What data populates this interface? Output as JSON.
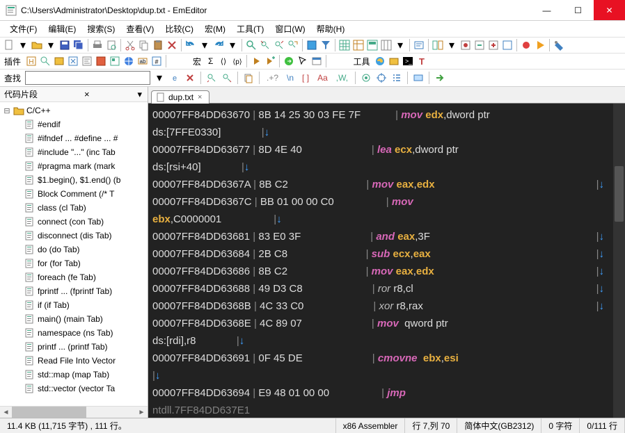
{
  "window": {
    "title": "C:\\Users\\Administrator\\Desktop\\dup.txt - EmEditor",
    "min": "—",
    "max": "☐",
    "close": "✕"
  },
  "menu": [
    "文件(F)",
    "编辑(E)",
    "搜索(S)",
    "查看(V)",
    "比较(C)",
    "宏(M)",
    "工具(T)",
    "窗口(W)",
    "帮助(H)"
  ],
  "toolbar2": {
    "plugins_label": "插件",
    "macros_label": "宏",
    "sigma": "Σ",
    "tools_label": "工具"
  },
  "search": {
    "label": "查找",
    "value": "",
    "tokens": [
      ".+?",
      "\\n",
      "[ ]",
      "Aa",
      ",W,"
    ]
  },
  "sidebar": {
    "title": "代码片段",
    "root": "C/C++",
    "items": [
      "#endif",
      "#ifndef ... #define ... #",
      "#include \"...\"  (inc Tab",
      "#pragma mark  (mark",
      "$1.begin(), $1.end()  (b",
      "Block Comment  (/* T",
      "class  (cl Tab)",
      "connect  (con Tab)",
      "disconnect  (dis Tab)",
      "do  (do Tab)",
      "for  (for Tab)",
      "foreach  (fe Tab)",
      "fprintf ...  (fprintf Tab)",
      "if  (if Tab)",
      "main()  (main Tab)",
      "namespace  (ns Tab)",
      "printf ...  (printf Tab)",
      "Read File Into Vector",
      "std::map  (map Tab)",
      "std::vector  (vector Ta"
    ]
  },
  "tab": {
    "label": "dup.txt"
  },
  "code": {
    "lines": [
      {
        "t": "a",
        "addr": "00007FF84DD63670",
        "hex": "8B 14 25 30 03 FE 7F",
        "mnem": "mov",
        "ops": [
          {
            "r": "edx"
          },
          {
            "p": ",dword ptr"
          }
        ]
      },
      {
        "t": "c",
        "txt": "ds:[7FFE0330]",
        "arrow": true
      },
      {
        "t": "a",
        "addr": "00007FF84DD63677",
        "hex": "8D 4E 40",
        "mnem": "lea",
        "ops": [
          {
            "r": "ecx"
          },
          {
            "p": ",dword ptr"
          }
        ]
      },
      {
        "t": "c",
        "txt": "ds:[rsi+40]",
        "arrow": true
      },
      {
        "t": "a",
        "addr": "00007FF84DD6367A",
        "hex": "8B C2",
        "mnem": "mov",
        "ops": [
          {
            "r": "eax"
          },
          {
            "p": ","
          },
          {
            "r": "edx"
          }
        ],
        "rarrow": true
      },
      {
        "t": "a",
        "addr": "00007FF84DD6367C",
        "hex": "BB 01 00 00 C0",
        "mnem": "mov",
        "ops": []
      },
      {
        "t": "c2",
        "reg": "ebx",
        "rest": ",C0000001",
        "arrow": true
      },
      {
        "t": "a",
        "addr": "00007FF84DD63681",
        "hex": "83 E0 3F",
        "mnem": "and",
        "ops": [
          {
            "r": "eax"
          },
          {
            "p": ",3F"
          }
        ],
        "rarrow": true
      },
      {
        "t": "a",
        "addr": "00007FF84DD63684",
        "hex": "2B C8",
        "mnem": "sub",
        "ops": [
          {
            "r": "ecx"
          },
          {
            "p": ","
          },
          {
            "r": "eax"
          }
        ],
        "rarrow": true
      },
      {
        "t": "a",
        "addr": "00007FF84DD63686",
        "hex": "8B C2",
        "mnem": "mov",
        "ops": [
          {
            "r": "eax"
          },
          {
            "p": ","
          },
          {
            "r": "edx"
          }
        ],
        "rarrow": true
      },
      {
        "t": "a",
        "addr": "00007FF84DD63688",
        "hex": "49 D3 C8",
        "mnem2": "ror",
        "ops": [
          {
            "p": " r8,cl"
          }
        ],
        "rarrow": true
      },
      {
        "t": "a",
        "addr": "00007FF84DD6368B",
        "hex": "4C 33 C0",
        "mnem2": "xor",
        "ops": [
          {
            "p": " r8,rax"
          }
        ],
        "rarrow": true
      },
      {
        "t": "a",
        "addr": "00007FF84DD6368E",
        "hex": "4C 89 07",
        "mnem": "mov",
        "ops": [
          {
            "p": " qword ptr"
          }
        ]
      },
      {
        "t": "c",
        "txt": "ds:[rdi],r8",
        "arrow": true
      },
      {
        "t": "a",
        "addr": "00007FF84DD63691",
        "hex": "0F 45 DE",
        "mnem": "cmovne",
        "ops": [
          {
            "r": " ebx"
          },
          {
            "p": ","
          },
          {
            "r": "esi"
          }
        ]
      },
      {
        "t": "ar"
      },
      {
        "t": "a",
        "addr": "00007FF84DD63694",
        "hex": "E9 48 01 00 00",
        "mnem": "jmp",
        "ops": []
      }
    ],
    "tail": "ntdll.7FF84DD637E1"
  },
  "status": {
    "left": "11.4 KB (11,715 字节) , 111 行。",
    "mode": "x86 Assembler",
    "pos": "行 7,列 70",
    "enc": "简体中文(GB2312)",
    "sel": "0 字符",
    "lines": "0/111 行"
  }
}
